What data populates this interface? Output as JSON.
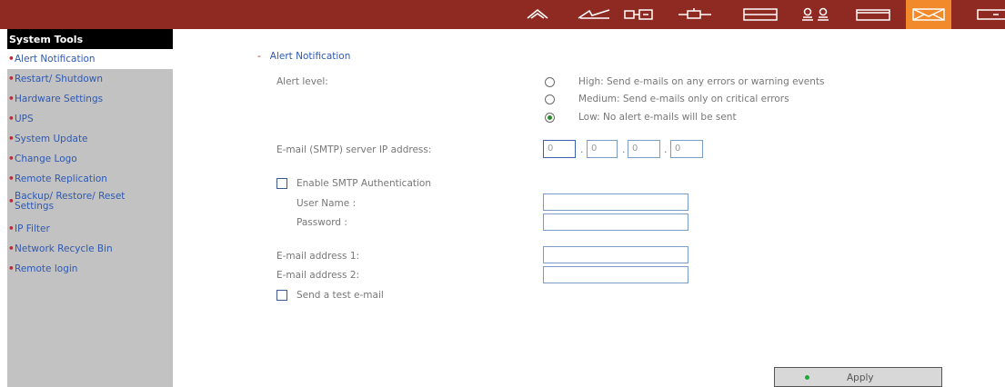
{
  "topbar": {
    "icons": [
      "home-icon",
      "network-icon",
      "device-icon",
      "plug-icon",
      "storage-icon",
      "users-icon",
      "folder-icon",
      "mail-icon",
      "more-icon"
    ],
    "colors": {
      "bar": "#8f2a22",
      "active": "#f28a2c"
    }
  },
  "sidebar": {
    "title": "System Tools",
    "items": [
      {
        "label": "Alert Notification",
        "active": true
      },
      {
        "label": "Restart/ Shutdown"
      },
      {
        "label": "Hardware Settings"
      },
      {
        "label": "UPS"
      },
      {
        "label": "System Update"
      },
      {
        "label": "Change Logo"
      },
      {
        "label": "Remote Replication"
      },
      {
        "label": "Backup/ Restore/ Reset Settings"
      },
      {
        "label": "IP Filter"
      },
      {
        "label": "Network Recycle Bin"
      },
      {
        "label": "Remote login"
      }
    ]
  },
  "main": {
    "section_marker": "-",
    "section_title": "Alert Notification",
    "alert_level_label": "Alert level:",
    "alert_options": [
      {
        "label": "High: Send e-mails on any errors or warning events",
        "selected": false
      },
      {
        "label": "Medium: Send e-mails only on critical errors",
        "selected": false
      },
      {
        "label": "Low: No alert e-mails will be sent",
        "selected": true
      }
    ],
    "smtp_label": "E-mail (SMTP) server IP address:",
    "smtp_ip": [
      "0",
      "0",
      "0",
      "0"
    ],
    "smtp_auth_label": "Enable SMTP Authentication",
    "smtp_auth_checked": false,
    "username_label": "User Name :",
    "username_value": "",
    "password_label": "Password :",
    "password_value": "",
    "email1_label": "E-mail address 1:",
    "email1_value": "",
    "email2_label": "E-mail address 2:",
    "email2_value": "",
    "test_email_label": "Send a test e-mail",
    "test_email_checked": false
  },
  "apply_label": "Apply"
}
